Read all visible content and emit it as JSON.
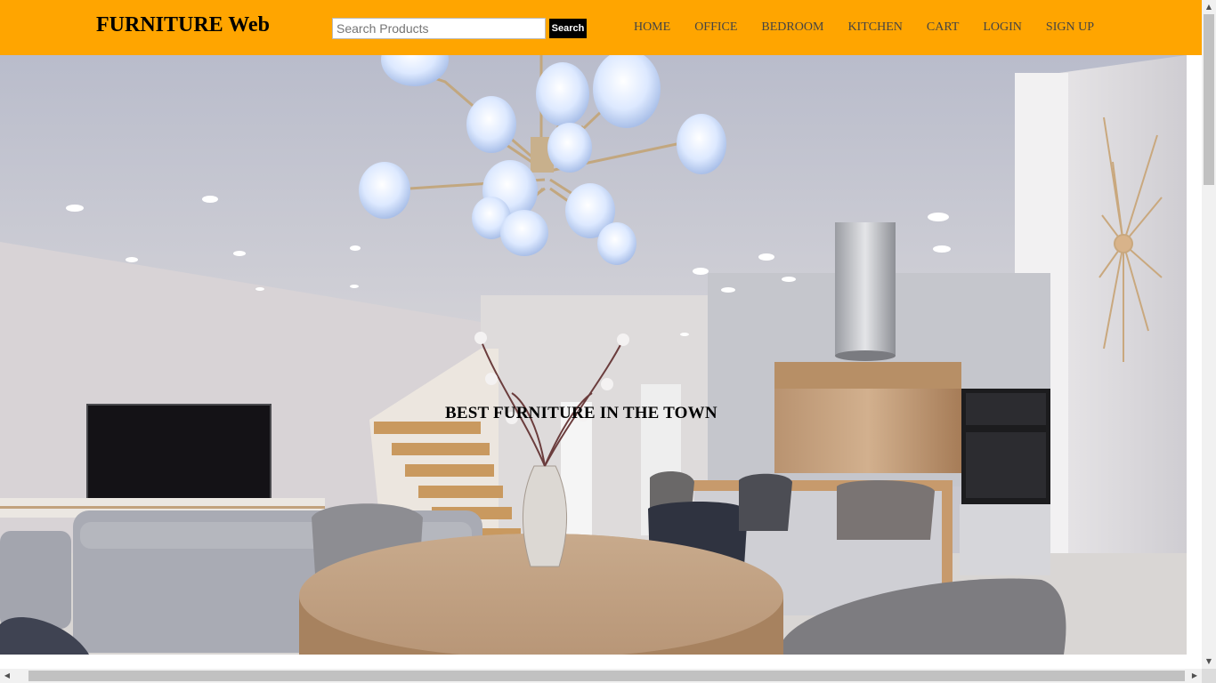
{
  "header": {
    "brand": "FURNITURE Web",
    "search": {
      "placeholder": "Search Products",
      "value": "",
      "button_label": "Search"
    },
    "nav": [
      {
        "label": "HOME"
      },
      {
        "label": "OFFICE"
      },
      {
        "label": "BEDROOM"
      },
      {
        "label": "KITCHEN"
      },
      {
        "label": "CART"
      },
      {
        "label": "LOGIN"
      },
      {
        "label": "SIGN UP"
      }
    ]
  },
  "hero": {
    "title": "BEST FURNITURE IN THE TOWN",
    "image": "modern living room and kitchen interior photo"
  },
  "colors": {
    "navbar": "#ffa500",
    "search_button": "#000000",
    "brand_text": "#000000",
    "nav_text": "#444444"
  },
  "icons": {
    "scroll_up": "triangle-up-icon",
    "scroll_down": "triangle-down-icon",
    "scroll_left": "triangle-left-icon",
    "scroll_right": "triangle-right-icon"
  }
}
